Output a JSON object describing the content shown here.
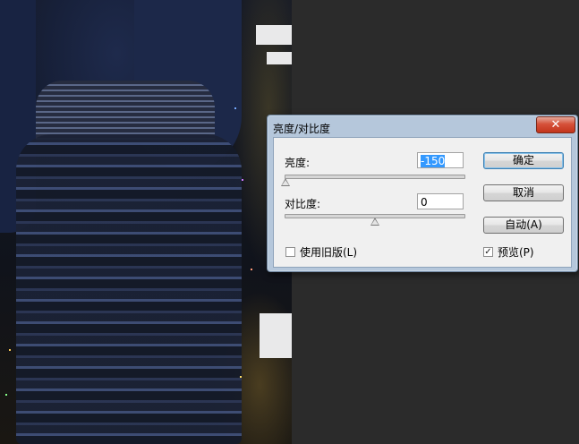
{
  "dialog": {
    "title": "亮度/对比度",
    "close_glyph": "✕",
    "brightness": {
      "label": "亮度:",
      "value": "-150",
      "slider_level_percent": 0
    },
    "contrast": {
      "label": "对比度:",
      "value": "0",
      "slider_level_percent": 50
    },
    "use_legacy": {
      "label": "使用旧版(L)",
      "checked": false
    },
    "preview": {
      "label": "预览(P)",
      "checked": true,
      "check_glyph": "✓"
    },
    "buttons": {
      "ok": "确定",
      "cancel": "取消",
      "auto": "自动(A)"
    }
  },
  "colors": {
    "workspace": "#2b2b2b",
    "dialog_frame": "#b5c7db",
    "close_button": "#d6513a",
    "selection": "#3399ff"
  },
  "icons": [
    "close-icon",
    "slider-thumb-icon",
    "checkbox-icon"
  ]
}
